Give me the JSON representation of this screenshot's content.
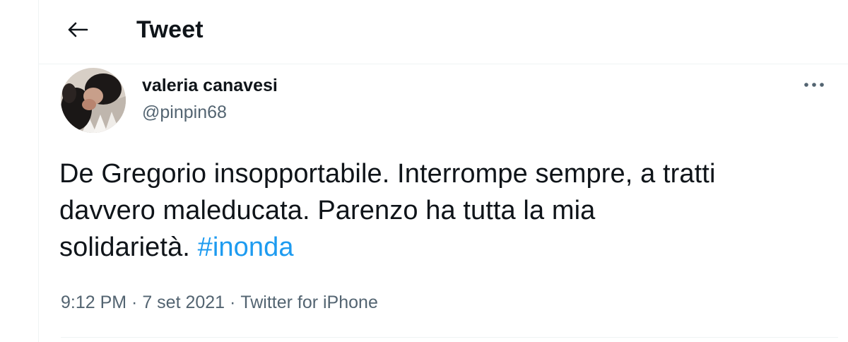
{
  "header": {
    "back_icon": "arrow-left-icon",
    "title": "Tweet"
  },
  "author": {
    "display_name": "valeria canavesi",
    "handle": "@pinpin68",
    "avatar_icon": "profile-photo"
  },
  "more_icon": "ellipsis-icon",
  "tweet": {
    "text_line_1": "De Gregorio insopportabile. Interrompe sempre, a tratti",
    "text_line_2": "davvero maleducata. Parenzo ha tutta la mia",
    "text_line_3_prefix": "solidarietà. ",
    "hashtag": "#inonda"
  },
  "meta": {
    "time": "9:12 PM",
    "separator": " · ",
    "date": "7 set 2021",
    "source": "Twitter for iPhone"
  },
  "colors": {
    "text_primary": "#0f1419",
    "text_secondary": "#536471",
    "link": "#1d9bf0",
    "divider": "#eff3f4"
  }
}
